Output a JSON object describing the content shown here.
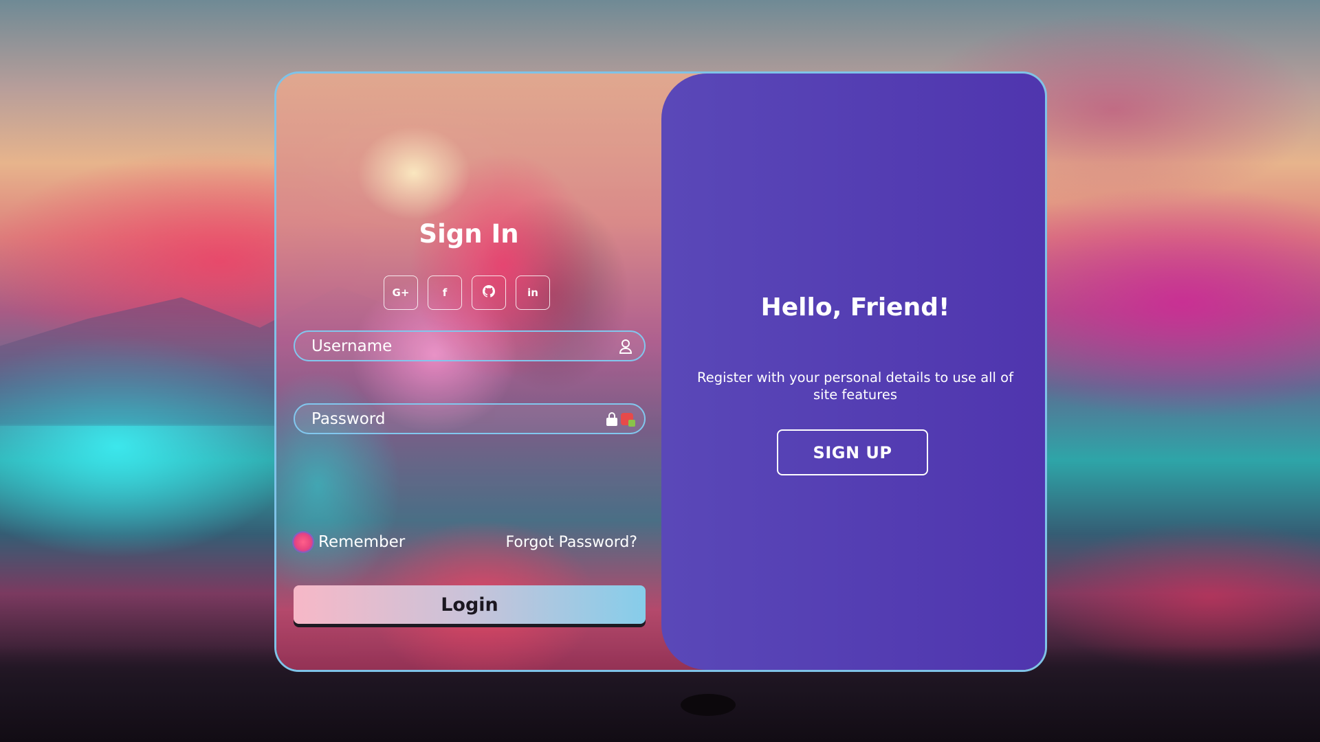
{
  "signin": {
    "title": "Sign In",
    "social_buttons": [
      {
        "label": "G+",
        "icon": "google-plus-icon"
      },
      {
        "label": "f",
        "icon": "facebook-icon"
      },
      {
        "label": "",
        "icon": "github-icon"
      },
      {
        "label": "in",
        "icon": "linkedin-icon"
      }
    ],
    "username_placeholder": "Username",
    "password_placeholder": "Password",
    "remember_label": "Remember",
    "forgot_label": "Forgot Password?",
    "login_label": "Login"
  },
  "panel": {
    "title": "Hello, Friend!",
    "text": "Register with your personal details to use all of site features",
    "signup_label": "SIGN UP"
  },
  "colors": {
    "card_border": "#7fc3e8",
    "panel_start": "#5a48b8",
    "panel_end": "#4f35ae",
    "login_gradient_start": "#f7b8c7",
    "login_gradient_end": "#86cdea",
    "checkbox_accent": "#e8467f"
  }
}
